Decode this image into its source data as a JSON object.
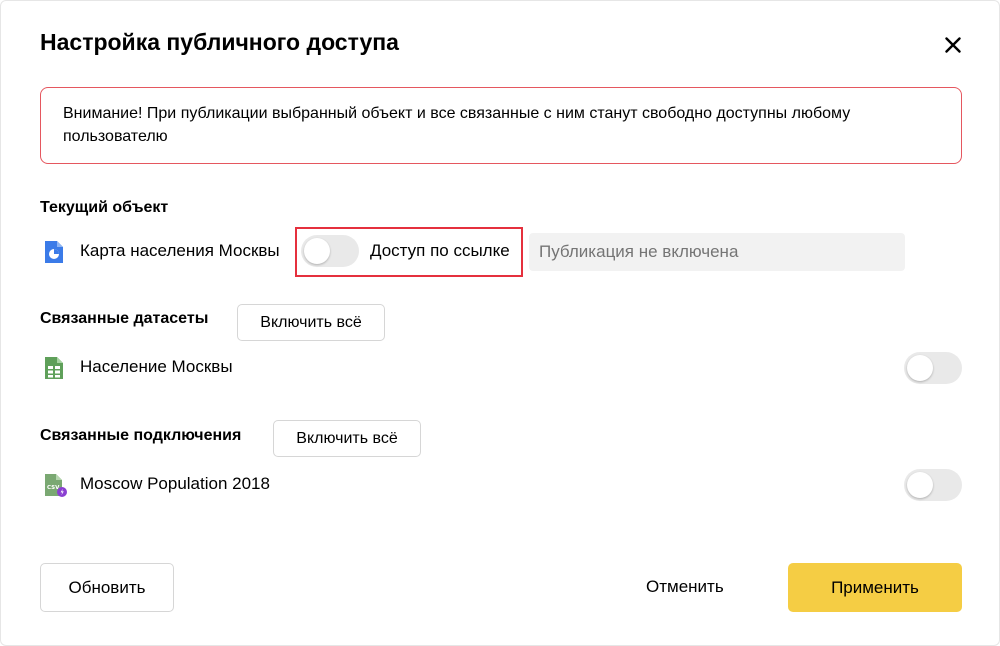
{
  "dialog": {
    "title": "Настройка публичного доступа",
    "warning": "Внимание! При публикации выбранный объект и все связанные с ним станут свободно доступны любому пользователю"
  },
  "current_object": {
    "section_title": "Текущий объект",
    "name": "Карта населения Москвы",
    "icon": "chart-icon",
    "toggle_on": false,
    "link_access_label": "Доступ по ссылке",
    "publication_placeholder": "Публикация не включена"
  },
  "datasets": {
    "section_title": "Связанные датасеты",
    "enable_all_label": "Включить всё",
    "items": [
      {
        "name": "Население Москвы",
        "icon": "dataset-icon",
        "toggle_on": false
      }
    ]
  },
  "connections": {
    "section_title": "Связанные подключения",
    "enable_all_label": "Включить всё",
    "items": [
      {
        "name": "Moscow Population 2018",
        "icon": "csv-connection-icon",
        "toggle_on": false
      }
    ]
  },
  "footer": {
    "refresh_label": "Обновить",
    "cancel_label": "Отменить",
    "apply_label": "Применить"
  },
  "colors": {
    "warning_border": "#e5575f",
    "highlight": "#e5303d",
    "primary": "#f5cd44",
    "chart_icon": "#3b7be8",
    "dataset_icon": "#5fa05a"
  }
}
